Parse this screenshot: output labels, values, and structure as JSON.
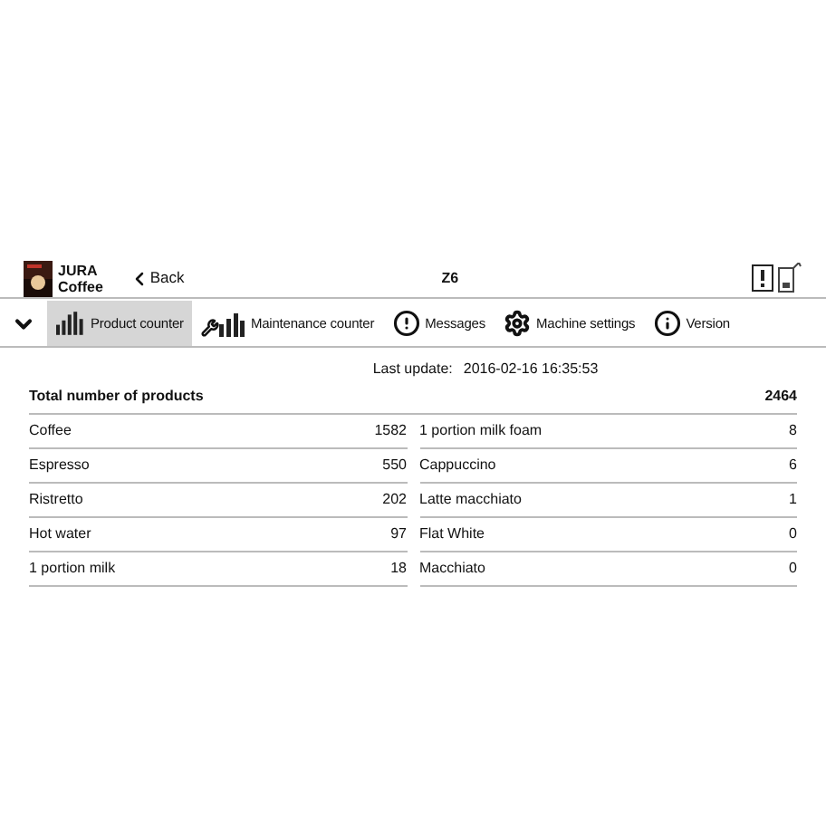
{
  "header": {
    "brand": "JURA",
    "subtitle": "Coffee",
    "back": "Back",
    "title": "Z6"
  },
  "tabs": [
    {
      "label": "Product counter",
      "kind": "bars",
      "selected": true
    },
    {
      "label": "Maintenance counter",
      "kind": "tools",
      "selected": false
    },
    {
      "label": "Messages",
      "kind": "alert",
      "selected": false
    },
    {
      "label": "Machine settings",
      "kind": "gear",
      "selected": false
    },
    {
      "label": "Version",
      "kind": "info",
      "selected": false
    }
  ],
  "last_update": {
    "label": "Last update:",
    "value": "2016-02-16 16:35:53"
  },
  "total": {
    "label": "Total number of products",
    "value": "2464"
  },
  "left": [
    {
      "name": "Coffee",
      "count": "1582"
    },
    {
      "name": "Espresso",
      "count": "550"
    },
    {
      "name": "Ristretto",
      "count": "202"
    },
    {
      "name": "Hot water",
      "count": "97"
    },
    {
      "name": "1 portion milk",
      "count": "18"
    }
  ],
  "right": [
    {
      "name": "1 portion milk foam",
      "count": "8"
    },
    {
      "name": "Cappuccino",
      "count": "6"
    },
    {
      "name": "Latte macchiato",
      "count": "1"
    },
    {
      "name": "Flat White",
      "count": "0"
    },
    {
      "name": "Macchiato",
      "count": "0"
    }
  ]
}
